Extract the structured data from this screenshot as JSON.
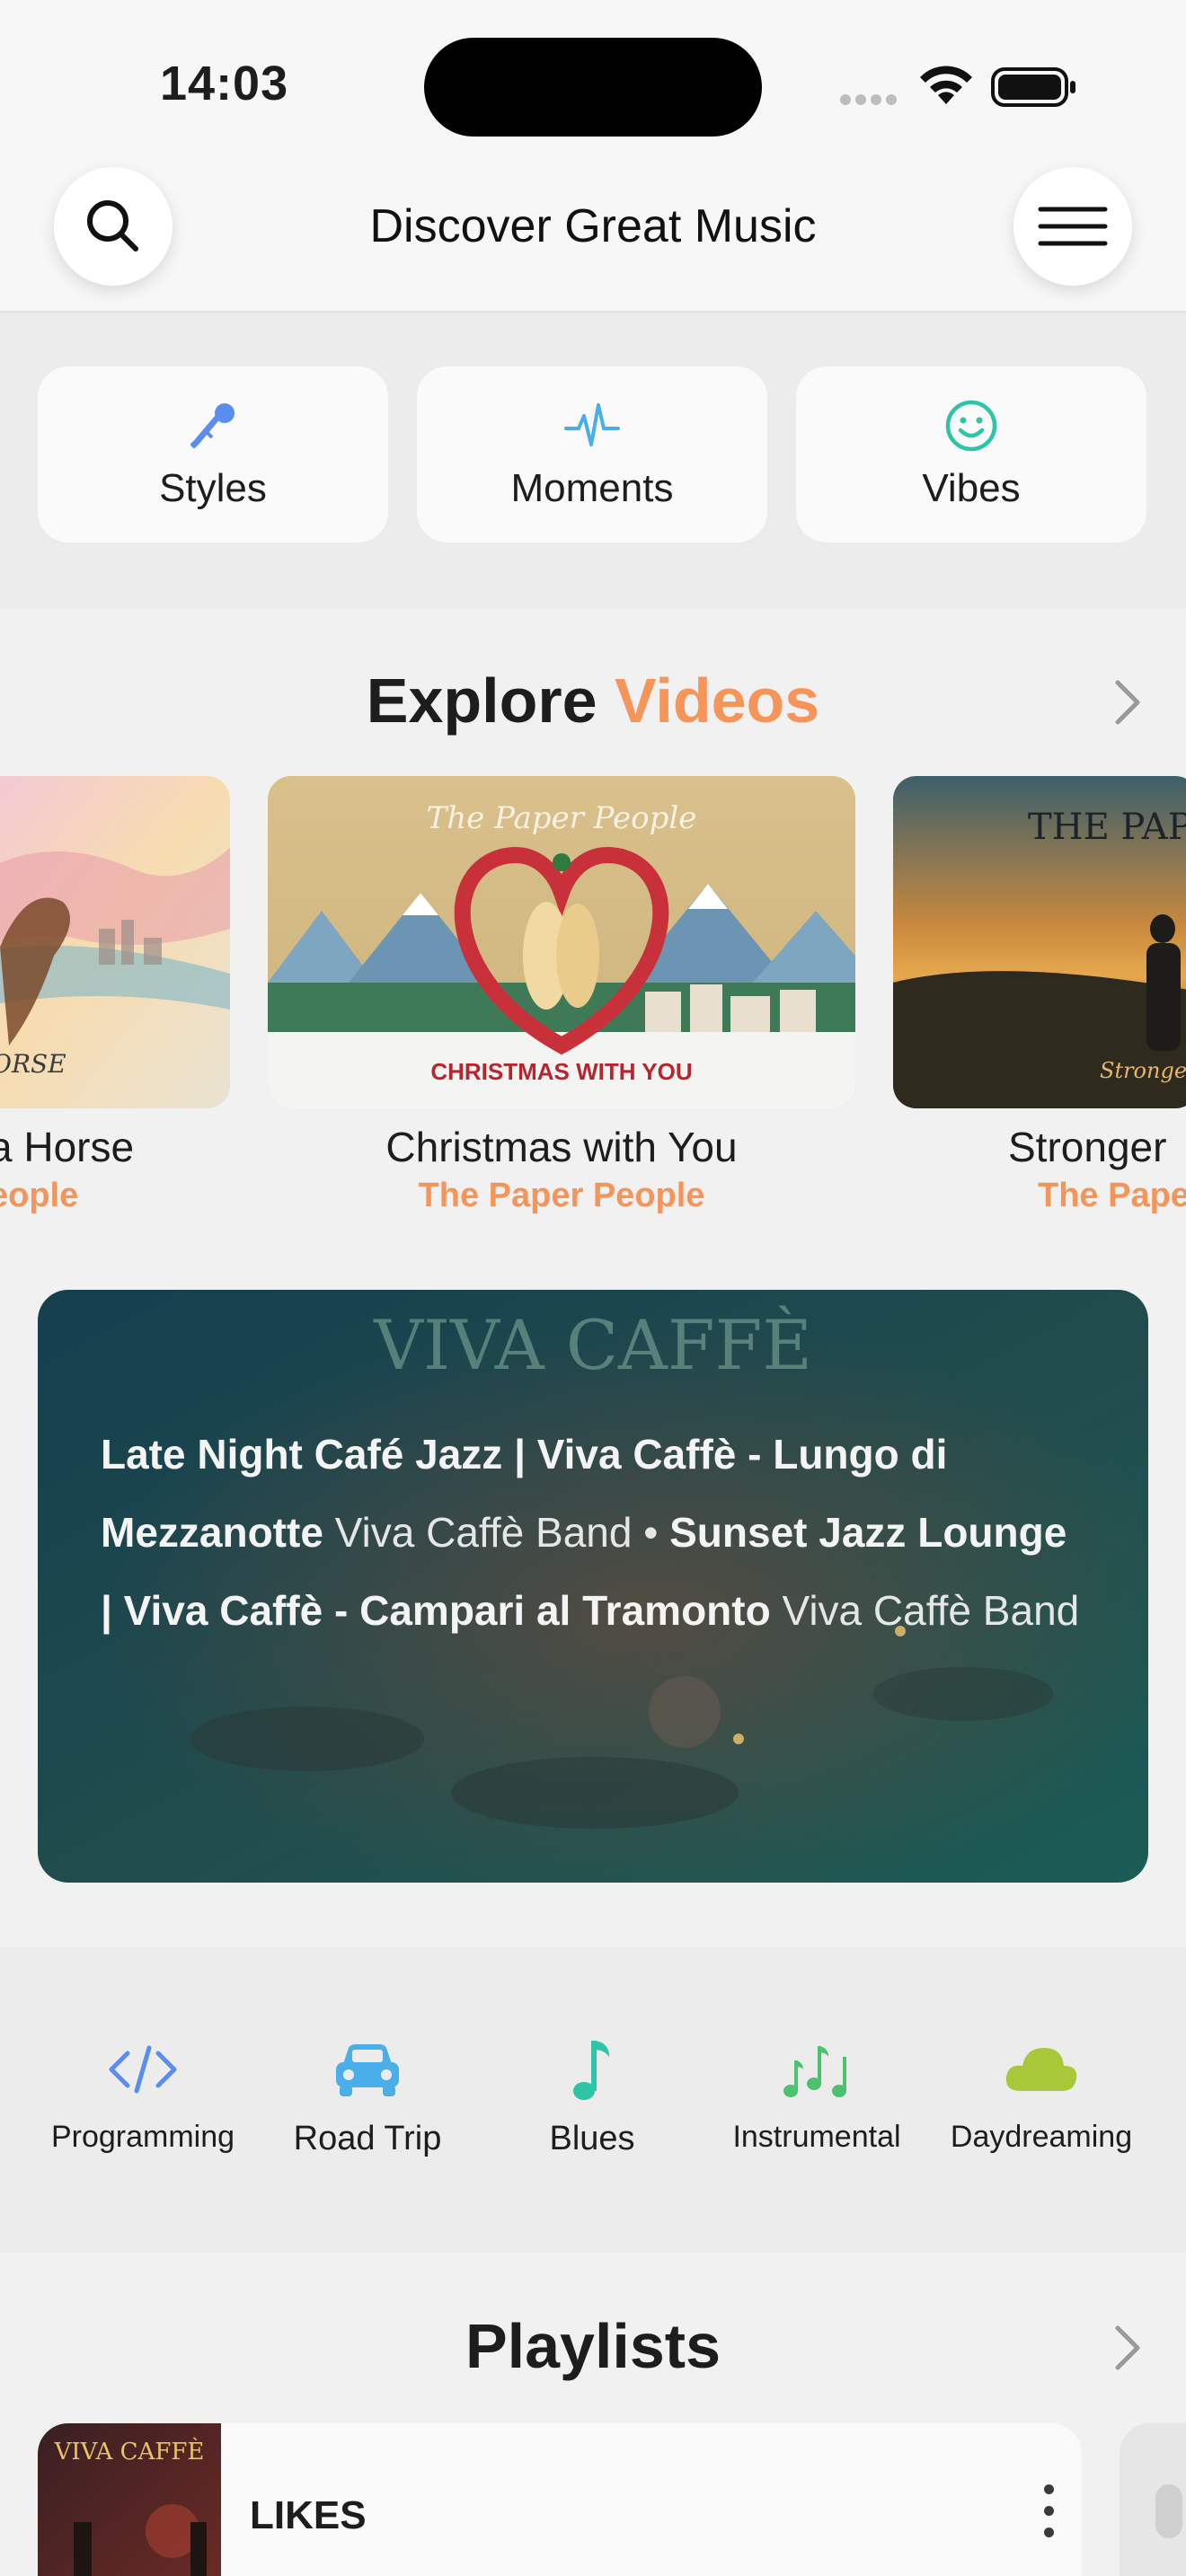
{
  "status_bar": {
    "time": "14:03"
  },
  "header": {
    "title": "Discover Great Music"
  },
  "categories": [
    {
      "label": "Styles",
      "icon": "microphone-icon",
      "color": "#5b8def"
    },
    {
      "label": "Moments",
      "icon": "pulse-icon",
      "color": "#4aaee8"
    },
    {
      "label": "Vibes",
      "icon": "smiley-icon",
      "color": "#2ec4a6"
    }
  ],
  "explore": {
    "title_main": "Explore",
    "title_accent": "Videos",
    "videos": [
      {
        "title": "a Horse",
        "artist": "eople",
        "thumb_text": "ORSE"
      },
      {
        "title": "Christmas with You",
        "artist": "The Paper People",
        "thumb_logo": "The Paper People",
        "thumb_caption": "CHRISTMAS WITH YOU"
      },
      {
        "title": "Stronger",
        "artist": "The Pape",
        "thumb_logo": "THE PAPE",
        "thumb_caption": "Stronger"
      }
    ],
    "featured": {
      "logo": "VIVA CAFFÈ",
      "track1_title": "Late Night Café Jazz | Viva Caffè - Lungo di Mezzanotte",
      "track1_artist": "Viva Caffè Band",
      "separator": "•",
      "track2_title": "Sunset Jazz Lounge | Viva Caffè - Campari al Tramonto",
      "track2_artist": "Viva Caffè Band"
    }
  },
  "moods": [
    {
      "label": "Programming",
      "icon": "code-icon",
      "color": "#5b8def"
    },
    {
      "label": "Road Trip",
      "icon": "car-icon",
      "color": "#4aaee8"
    },
    {
      "label": "Blues",
      "icon": "music-note-icon",
      "color": "#2ec4a6"
    },
    {
      "label": "Instrumental",
      "icon": "music-notes-icon",
      "color": "#4cc26e"
    },
    {
      "label": "Daydreaming",
      "icon": "cloud-icon",
      "color": "#a8c83a"
    }
  ],
  "playlists": {
    "title": "Playlists",
    "items": [
      {
        "name": "LIKES",
        "art_logo": "VIVA CAFFÈ"
      }
    ]
  },
  "colors": {
    "accent": "#f5955a",
    "background": "#f1f1f1"
  }
}
